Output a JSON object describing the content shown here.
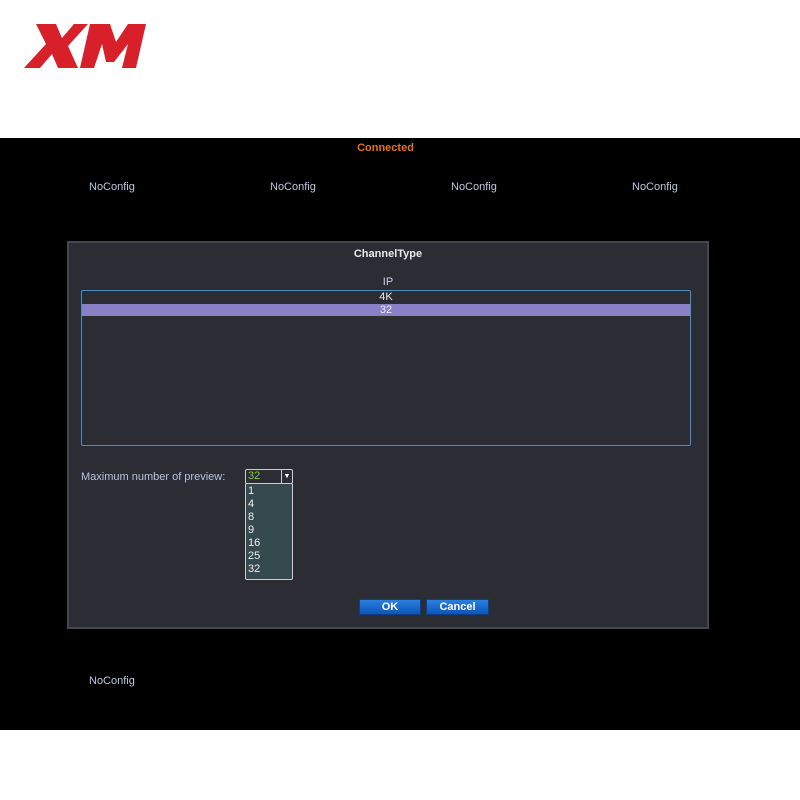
{
  "logo": {
    "text": "XM",
    "color": "#d8202a"
  },
  "status": "Connected",
  "channels_top": [
    "NoConfig",
    "NoConfig",
    "NoConfig",
    "NoConfig"
  ],
  "channels_bottom": [
    "NoConfig"
  ],
  "dialog": {
    "title": "ChannelType",
    "column_header": "IP",
    "rows": [
      "4K",
      "32"
    ],
    "selected_row": "32",
    "preview_label": "Maximum number of preview:",
    "preview_value": "32",
    "preview_options": [
      "1",
      "4",
      "8",
      "9",
      "16",
      "25",
      "32"
    ],
    "ok": "OK",
    "cancel": "Cancel"
  }
}
